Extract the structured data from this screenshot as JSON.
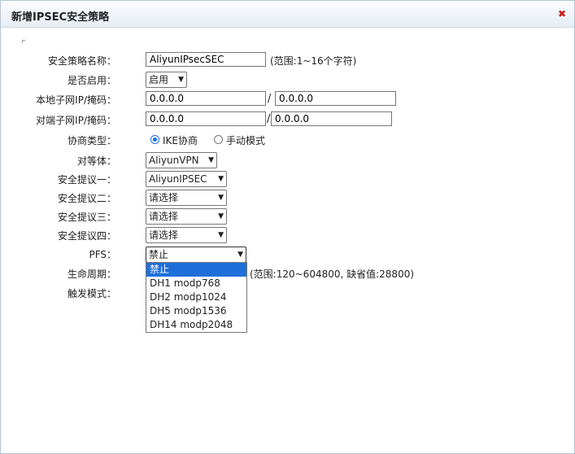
{
  "dialog": {
    "title": "新增IPSEC安全策略",
    "close_symbol": "✖"
  },
  "form": {
    "policy_name": {
      "label": "安全策略名称：",
      "value": "AliyunIPsecSEC",
      "hint": "(范围:1~16个字符)"
    },
    "enabled": {
      "label": "是否启用：",
      "value": "启用"
    },
    "local_subnet": {
      "label": "本地子网IP/掩码：",
      "ip": "0.0.0.0",
      "mask": "0.0.0.0",
      "separator": "/"
    },
    "remote_subnet": {
      "label": "对端子网IP/掩码：",
      "ip": "0.0.0.0",
      "mask": "0.0.0.0",
      "separator": "/"
    },
    "negotiation": {
      "label": "协商类型：",
      "options": [
        "IKE协商",
        "手动模式"
      ],
      "selected": "IKE协商"
    },
    "peer": {
      "label": "对等体：",
      "value": "AliyunVPN"
    },
    "proposal1": {
      "label": "安全提议一：",
      "value": "AliyunIPSEC"
    },
    "proposal2": {
      "label": "安全提议二：",
      "value": "请选择"
    },
    "proposal3": {
      "label": "安全提议三：",
      "value": "请选择"
    },
    "proposal4": {
      "label": "安全提议四：",
      "value": "请选择"
    },
    "pfs": {
      "label": "PFS：",
      "value": "禁止",
      "options": [
        "禁止",
        "DH1 modp768",
        "DH2 modp1024",
        "DH5 modp1536",
        "DH14 modp2048"
      ]
    },
    "lifetime": {
      "label": "生命周期：",
      "hint": "(范围:120~604800, 缺省值:28800)"
    },
    "trigger": {
      "label": "触发模式："
    }
  },
  "colors": {
    "accent": "#1e6fd9",
    "close": "#d01818"
  },
  "icons": {
    "close": "close-icon",
    "dropdown": "chevron-down-icon"
  }
}
